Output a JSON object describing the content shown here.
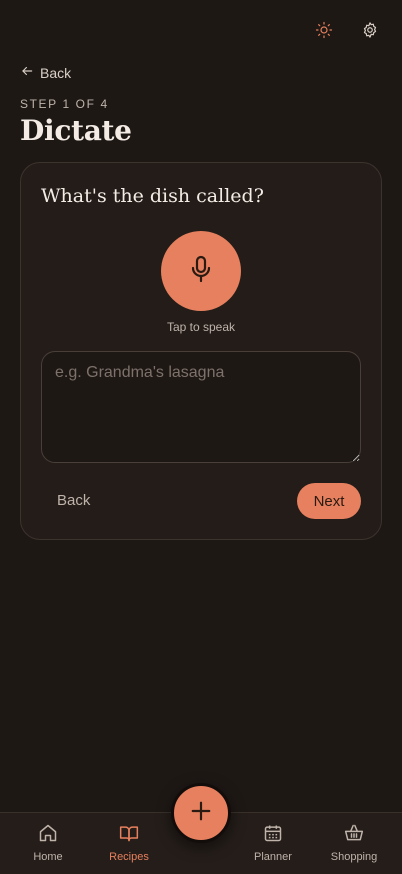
{
  "header": {
    "icons": [
      "sun-icon",
      "gear-icon"
    ],
    "back_label": "Back",
    "step_label": "STEP 1 OF 4",
    "title": "Dictate"
  },
  "card": {
    "question": "What's the dish called?",
    "mic_caption": "Tap to speak",
    "input_placeholder": "e.g. Grandma's lasagna",
    "input_value": "",
    "back_label": "Back",
    "next_label": "Next"
  },
  "nav": {
    "items": [
      {
        "label": "Home",
        "icon": "home-icon",
        "active": false
      },
      {
        "label": "Recipes",
        "icon": "book-icon",
        "active": true
      },
      {
        "label": "Planner",
        "icon": "calendar-icon",
        "active": false
      },
      {
        "label": "Shopping",
        "icon": "basket-icon",
        "active": false
      }
    ],
    "fab_icon": "plus-icon"
  },
  "colors": {
    "accent": "#e6805e",
    "background": "#1e1815",
    "card": "#231c18",
    "text": "#efe6df",
    "muted": "#bfb3aa"
  }
}
